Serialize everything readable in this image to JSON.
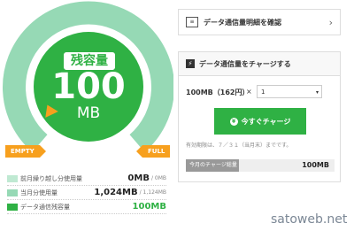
{
  "gauge": {
    "badge": "残容量",
    "value": "100",
    "unit": "MB",
    "empty_label": "EMPTY",
    "full_label": "FULL",
    "colors": {
      "ring_light": "#96d9b5",
      "ring_green": "#2fb144",
      "marker": "#f7a01e"
    }
  },
  "legend": {
    "rows": [
      {
        "label": "前月繰り越し分使用量",
        "value": "0MB",
        "sub": "/ 0MB",
        "color": "#bfe9d2"
      },
      {
        "label": "当月分使用量",
        "value": "1,024MB",
        "sub": "/ 1,124MB",
        "color": "#96d9b5"
      },
      {
        "label": "データ通信残容量",
        "value": "100MB",
        "sub": "",
        "color": "#2fb144"
      }
    ]
  },
  "confirm": {
    "label": "データ通信量明細を確認",
    "icon": "document-icon"
  },
  "charge": {
    "title": "データ通信量をチャージする",
    "quantity_label": "100MB（162円）",
    "times": "×",
    "select_value": "1",
    "button": "今すぐチャージ",
    "expiry": "有効期限は、７／３１（当月末）までです。",
    "bar_label": "今月のチャージ総量",
    "bar_amount": "100MB",
    "bar_fill_fraction": 0.36
  },
  "watermark": "satoweb.net"
}
